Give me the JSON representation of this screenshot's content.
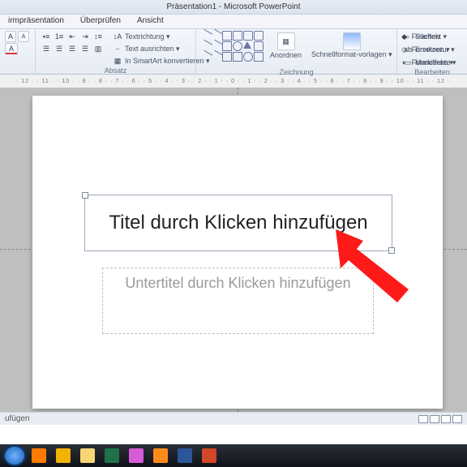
{
  "title": "Präsentation1  -  Microsoft PowerPoint",
  "tabs": [
    "irmpräsentation",
    "Überprüfen",
    "Ansicht"
  ],
  "ribbon": {
    "font": {
      "buttons": [
        "A",
        "A"
      ]
    },
    "para": {
      "label": "Absatz",
      "items": [
        "Textrichtung ▾",
        "Text ausrichten ▾",
        "In SmartArt konvertieren ▾"
      ]
    },
    "draw": {
      "label": "Zeichnung",
      "arrange": "Anordnen",
      "quick": "Schnellformat-vorlagen ▾",
      "fill": "Fülleffekt ▾",
      "contour": "Formkontur ▾",
      "effects": "Formeffekte ▾"
    },
    "edit": {
      "label": "Bearbeiten",
      "find": "Suchen",
      "replace": "Ersetzen ▾",
      "select": "Markieren ▾"
    }
  },
  "ruler": "· 12 · · 11 · · 10 · · 9 · · 8 · · 7 · · 6 · · 5 · · 4 · · 3 · · 2 · · 1 · · 0 · · 1 · · 2 · · 3 · · 4 · · 5 · · 6 · · 7 · · 8 · · 9 · · 10 · · 11 · · 12 ·",
  "slide": {
    "title_placeholder": "Titel durch Klicken hinzufügen",
    "subtitle_placeholder": "Untertitel durch Klicken hinzufügen"
  },
  "footer": "ufügen",
  "taskbar": {
    "apps": [
      {
        "name": "firefox",
        "color": "#ff7b00"
      },
      {
        "name": "outlook",
        "color": "#f2b200"
      },
      {
        "name": "folder",
        "color": "#f7d774"
      },
      {
        "name": "excel",
        "color": "#1f7246"
      },
      {
        "name": "paint",
        "color": "#d85bd8"
      },
      {
        "name": "media",
        "color": "#ff8c1a"
      },
      {
        "name": "word",
        "color": "#2b579a"
      },
      {
        "name": "powerpoint",
        "color": "#d24726"
      }
    ]
  }
}
